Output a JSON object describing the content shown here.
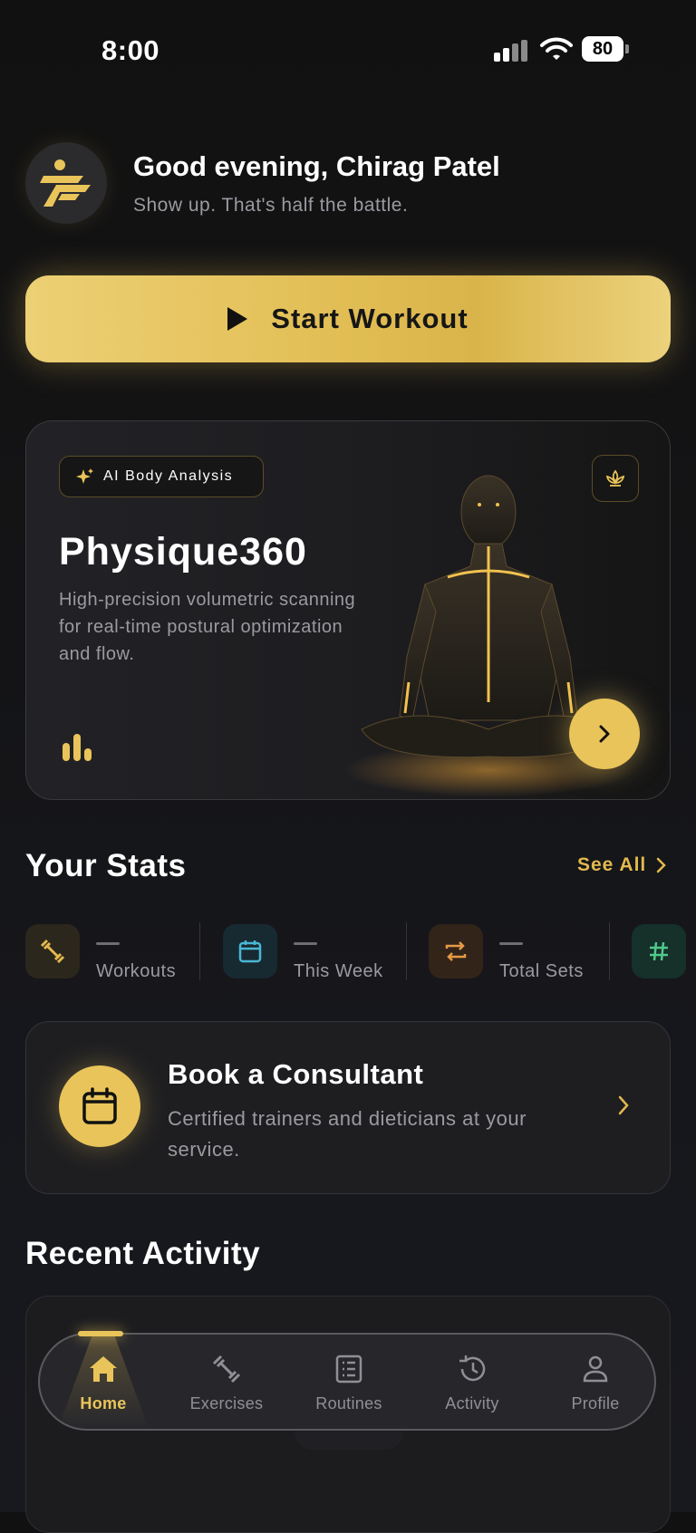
{
  "status_bar": {
    "time": "8:00",
    "battery": "80"
  },
  "header": {
    "greeting": "Good evening, Chirag Patel",
    "subtitle": "Show up. That's half the battle."
  },
  "start_workout": {
    "label": "Start Workout"
  },
  "physique_card": {
    "badge": "AI Body Analysis",
    "title": "Physique360",
    "description": "High-precision volumetric scanning for real-time postural optimization and flow."
  },
  "stats": {
    "title": "Your Stats",
    "see_all": "See All",
    "items": [
      {
        "label": "Workouts",
        "value": "—",
        "icon": "dumbbell-icon",
        "color": "#e3b94e"
      },
      {
        "label": "This Week",
        "value": "—",
        "icon": "calendar-icon",
        "color": "#49b7d6"
      },
      {
        "label": "Total Sets",
        "value": "—",
        "icon": "repeat-icon",
        "color": "#e79a45"
      },
      {
        "label": "",
        "value": "",
        "icon": "hash-icon",
        "color": "#4fc98a"
      }
    ]
  },
  "consultant": {
    "title": "Book a Consultant",
    "description": "Certified trainers and dieticians at your service."
  },
  "recent_activity": {
    "title": "Recent Activity"
  },
  "nav": {
    "items": [
      {
        "label": "Home",
        "icon": "home-icon",
        "active": true
      },
      {
        "label": "Exercises",
        "icon": "dumbbell-icon"
      },
      {
        "label": "Routines",
        "icon": "list-icon"
      },
      {
        "label": "Activity",
        "icon": "history-icon"
      },
      {
        "label": "Profile",
        "icon": "profile-icon"
      }
    ]
  },
  "colors": {
    "accent": "#e9c45a",
    "background": "#141416",
    "card": "#1e1e21"
  }
}
